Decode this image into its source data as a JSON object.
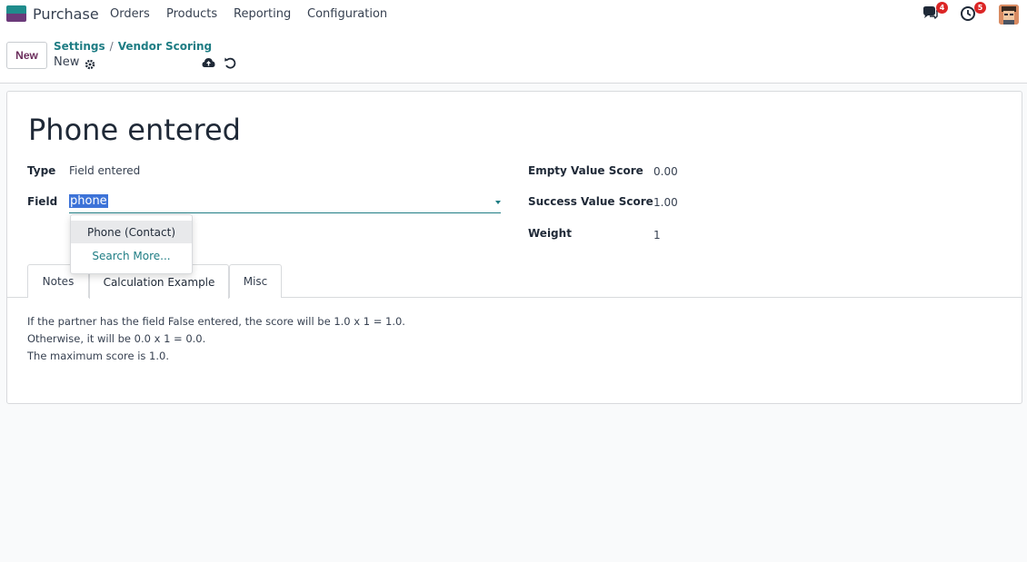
{
  "topbar": {
    "app_name": "Purchase",
    "menu": [
      "Orders",
      "Products",
      "Reporting",
      "Configuration"
    ],
    "messages_count": "4",
    "activities_count": "5"
  },
  "controlbar": {
    "new_label": "New",
    "breadcrumb": [
      "Settings",
      "Vendor Scoring"
    ],
    "record_name": "New"
  },
  "form": {
    "title": "Phone entered",
    "type_label": "Type",
    "type_value": "Field entered",
    "field_label": "Field",
    "field_value": "phone",
    "empty_score_label": "Empty Value Score",
    "empty_score_value": "0.00",
    "success_score_label": "Success Value Score",
    "success_score_value": "1.00",
    "weight_label": "Weight",
    "weight_value": "1"
  },
  "dropdown": {
    "items": [
      "Phone (Contact)"
    ],
    "search_more": "Search More..."
  },
  "tabs": [
    "Notes",
    "Calculation Example",
    "Misc"
  ],
  "calculation": [
    "If the partner has the field False entered, the score will be 1.0 x 1 = 1.0.",
    "Otherwise, it will be 0.0 x 1 = 0.0.",
    "The maximum score is 1.0."
  ],
  "colors": {
    "accent": "#1f7d84",
    "brand": "#6b2d5c",
    "badge": "#dc2626"
  }
}
